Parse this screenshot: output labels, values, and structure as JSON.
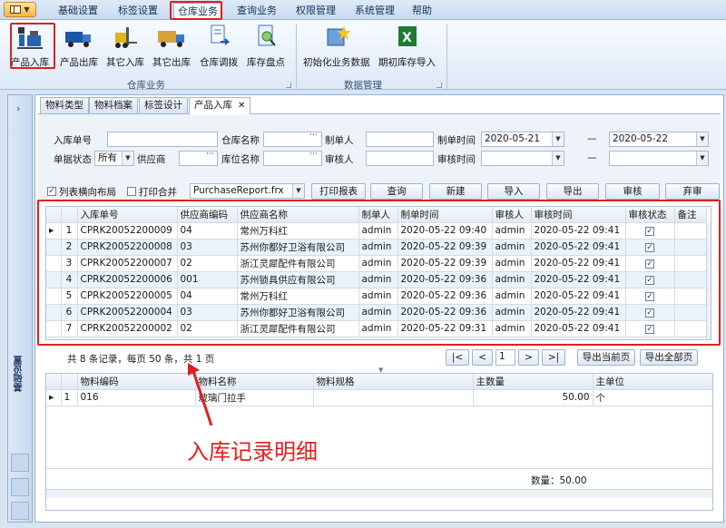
{
  "menu": {
    "items": [
      "基础设置",
      "标签设置",
      "仓库业务",
      "查询业务",
      "权限管理",
      "系统管理",
      "帮助"
    ],
    "active_index": 2
  },
  "ribbon": {
    "group1_label": "仓库业务",
    "group2_label": "数据管理",
    "buttons": [
      "产品入库",
      "产品出库",
      "其它入库",
      "其它出库",
      "仓库调拨",
      "库存盘点",
      "初始化业务数据",
      "期初库存导入"
    ]
  },
  "leftpanel": {
    "label": "基础设置"
  },
  "tabs": [
    "物料类型",
    "物料档案",
    "标签设计",
    "产品入库"
  ],
  "tab_close": "✕",
  "form": {
    "labels": {
      "order_no": "入库单号",
      "warehouse": "仓库名称",
      "maker": "制单人",
      "make_time": "制单时间",
      "status": "单据状态",
      "supplier": "供应商",
      "location": "库位名称",
      "auditor": "审核人",
      "audit_time": "审核时间"
    },
    "status_value": "所有",
    "date_from": "2020-05-21",
    "date_to": "2020-05-22",
    "dash": "—",
    "ellipsis": "···",
    "list_layout_label": "列表横向布局",
    "print_merge_label": "打印合并",
    "report_value": "PurchaseReport.frx"
  },
  "toolbar": {
    "print": "打印报表",
    "query": "查询",
    "new": "新建",
    "import": "导入",
    "export": "导出",
    "audit": "审核",
    "unaudit": "弃审"
  },
  "grid1": {
    "headers": [
      "入库单号",
      "供应商编码",
      "供应商名称",
      "制单人",
      "制单时间",
      "审核人",
      "审核时间",
      "审核状态",
      "备注"
    ],
    "rows": [
      {
        "idx": "1",
        "no": "CPRK20052200009",
        "code": "04",
        "name": "常州万科红",
        "maker": "admin",
        "mtime": "2020-05-22 09:40",
        "auditor": "admin",
        "atime": "2020-05-22 09:41"
      },
      {
        "idx": "2",
        "no": "CPRK20052200008",
        "code": "03",
        "name": "苏州你都好卫浴有限公司",
        "maker": "admin",
        "mtime": "2020-05-22 09:39",
        "auditor": "admin",
        "atime": "2020-05-22 09:41"
      },
      {
        "idx": "3",
        "no": "CPRK20052200007",
        "code": "02",
        "name": "浙江灵犀配件有限公司",
        "maker": "admin",
        "mtime": "2020-05-22 09:39",
        "auditor": "admin",
        "atime": "2020-05-22 09:41"
      },
      {
        "idx": "4",
        "no": "CPRK20052200006",
        "code": "001",
        "name": "苏州锁具供应有限公司",
        "maker": "admin",
        "mtime": "2020-05-22 09:36",
        "auditor": "admin",
        "atime": "2020-05-22 09:41"
      },
      {
        "idx": "5",
        "no": "CPRK20052200005",
        "code": "04",
        "name": "常州万科红",
        "maker": "admin",
        "mtime": "2020-05-22 09:36",
        "auditor": "admin",
        "atime": "2020-05-22 09:41"
      },
      {
        "idx": "6",
        "no": "CPRK20052200004",
        "code": "03",
        "name": "苏州你都好卫浴有限公司",
        "maker": "admin",
        "mtime": "2020-05-22 09:36",
        "auditor": "admin",
        "atime": "2020-05-22 09:41"
      },
      {
        "idx": "7",
        "no": "CPRK20052200002",
        "code": "02",
        "name": "浙江灵犀配件有限公司",
        "maker": "admin",
        "mtime": "2020-05-22 09:31",
        "auditor": "admin",
        "atime": "2020-05-22 09:41"
      }
    ]
  },
  "pager": {
    "summary": "共 8 条记录，每页 50 条，共 1 页",
    "page": "1",
    "first": "|<",
    "prev": "<",
    "next": ">",
    "last": ">|",
    "export_page": "导出当前页",
    "export_all": "导出全部页"
  },
  "grid2": {
    "headers": [
      "物料编码",
      "物料名称",
      "物料规格",
      "主数量",
      "主单位"
    ],
    "row": {
      "idx": "1",
      "code": "016",
      "name": "玻璃门拉手",
      "spec": "",
      "qty": "50.00",
      "unit": "个"
    },
    "footer": "数量：50.00"
  },
  "annotation": "入库记录明细",
  "colors": {
    "accent_red": "#e0201d",
    "ribbon_blue": "#dde9f6"
  }
}
